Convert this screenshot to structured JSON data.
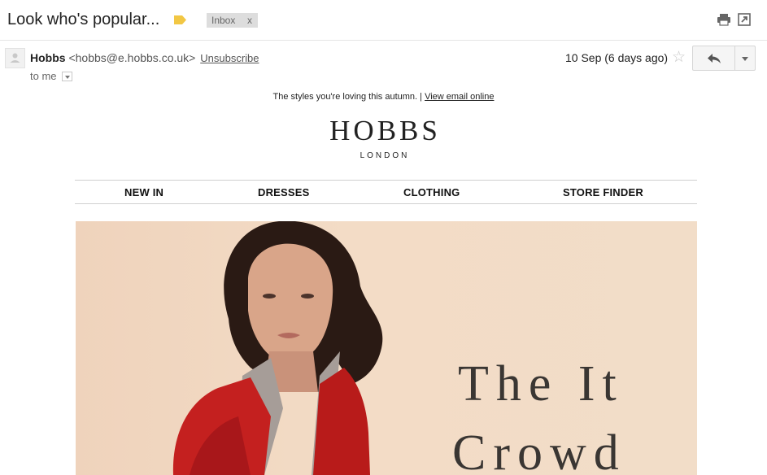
{
  "thread": {
    "subject": "Look who's popular...",
    "label_color": "#f2c744",
    "inbox_chip": {
      "label": "Inbox",
      "remove": "x"
    }
  },
  "message": {
    "sender_name": "Hobbs",
    "sender_email": "<hobbs@e.hobbs.co.uk>",
    "unsubscribe": "Unsubscribe",
    "to_label": "to me",
    "date": "10 Sep (6 days ago)",
    "star": "☆"
  },
  "email": {
    "preheader_text": "The styles you're loving this autumn.",
    "preheader_sep": "|",
    "view_online": "View email online",
    "brand": "HOBBS",
    "brand_sub": "LONDON",
    "nav": [
      "NEW IN",
      "DRESSES",
      "CLOTHING",
      "STORE FINDER"
    ],
    "hero": {
      "title_line1": "The It",
      "title_line2": "Crowd",
      "background": "#f2dcc6",
      "coat_color": "#c4201f"
    }
  },
  "icons": {
    "label": "label-tag-icon",
    "print": "print-icon",
    "new_window": "new-window-icon",
    "star": "star-icon",
    "reply": "reply-arrow-icon",
    "more": "chevron-down-icon",
    "avatar": "person-icon"
  }
}
